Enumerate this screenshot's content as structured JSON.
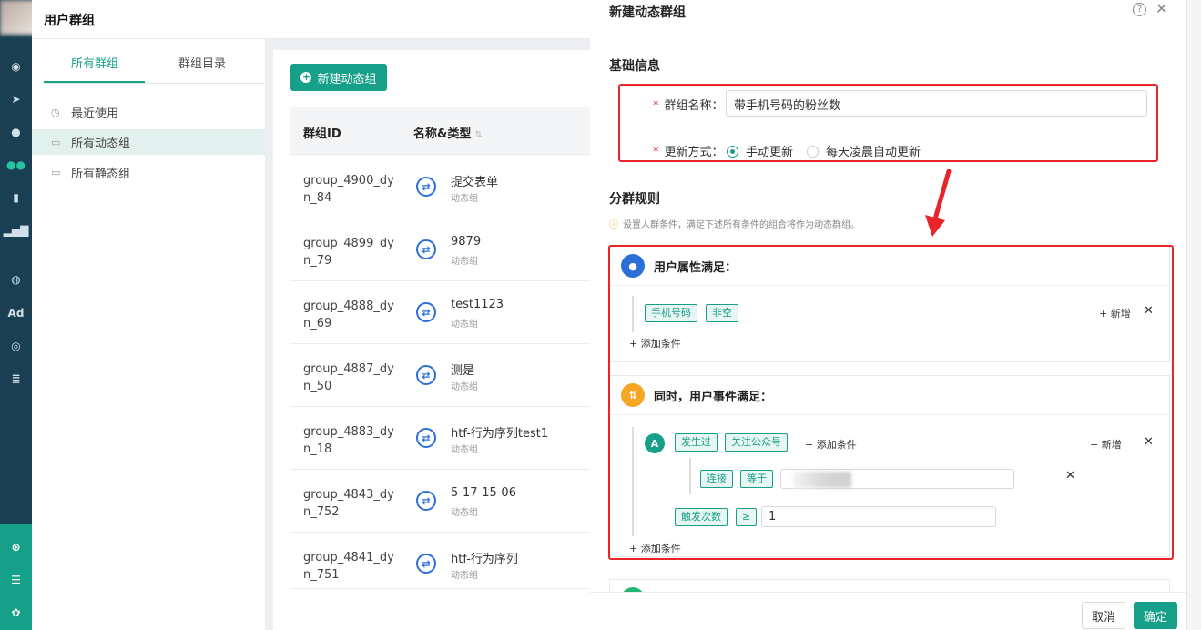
{
  "page": {
    "title": "用户群组"
  },
  "left_tabs": [
    {
      "label": "所有群组",
      "active": true
    },
    {
      "label": "群组目录",
      "active": false
    }
  ],
  "left_menu": [
    {
      "label": "最近使用",
      "icon": "clock-icon"
    },
    {
      "label": "所有动态组",
      "icon": "folder-icon",
      "selected": true
    },
    {
      "label": "所有静态组",
      "icon": "folder-icon"
    }
  ],
  "rail_icons": [
    "dashboard-icon",
    "send-icon",
    "user-icon",
    "users-icon",
    "bookmark-icon",
    "bar-chart-icon",
    "wechat-icon",
    "Ad",
    "target-icon",
    "list-icon",
    "network-icon",
    "server-icon",
    "gear-icon"
  ],
  "new_button": "新建动态组",
  "table": {
    "headers": [
      "群组ID",
      "名称&类型"
    ],
    "rows": [
      {
        "id": "group_4900_dyn_84",
        "name": "提交表单",
        "type": "动态组"
      },
      {
        "id": "group_4899_dyn_79",
        "name": "9879",
        "type": "动态组"
      },
      {
        "id": "group_4888_dyn_69",
        "name": "test1123",
        "type": "动态组"
      },
      {
        "id": "group_4887_dyn_50",
        "name": "测是",
        "type": "动态组"
      },
      {
        "id": "group_4883_dyn_18",
        "name": "htf-行为序列test1",
        "type": "动态组"
      },
      {
        "id": "group_4843_dyn_752",
        "name": "5-17-15-06",
        "type": "动态组"
      },
      {
        "id": "group_4841_dyn_751",
        "name": "htf-行为序列",
        "type": "动态组"
      }
    ]
  },
  "drawer": {
    "title": "新建动态群组",
    "basic_section": "基础信息",
    "name_label": "群组名称：",
    "name_value": "带手机号码的粉丝数",
    "update_label": "更新方式：",
    "update_options": [
      {
        "label": "手动更新",
        "checked": true
      },
      {
        "label": "每天凌晨自动更新",
        "checked": false
      }
    ],
    "rules_section": "分群规则",
    "rules_hint": "设置人群条件，满足下述所有条件的组合将作为动态群组。",
    "attr_block": {
      "title": "用户属性满足：",
      "tags": [
        "手机号码",
        "非空"
      ],
      "add_new": "+ 新增",
      "add_condition": "+ 添加条件"
    },
    "event_block": {
      "title": "同时，用户事件满足：",
      "letter": "A",
      "tags": [
        "发生过",
        "关注公众号"
      ],
      "inline_add": "+ 添加条件",
      "add_new": "+ 新增",
      "sub_tags": [
        "连接",
        "等于"
      ],
      "count_tags": [
        "触发次数",
        "≥"
      ],
      "count_value": "1",
      "add_condition": "+ 添加条件"
    },
    "cancel": "取消",
    "confirm": "确定"
  },
  "colors": {
    "accent": "#16a089",
    "highlight": "#e8262a",
    "rail": "#1b3f52"
  }
}
